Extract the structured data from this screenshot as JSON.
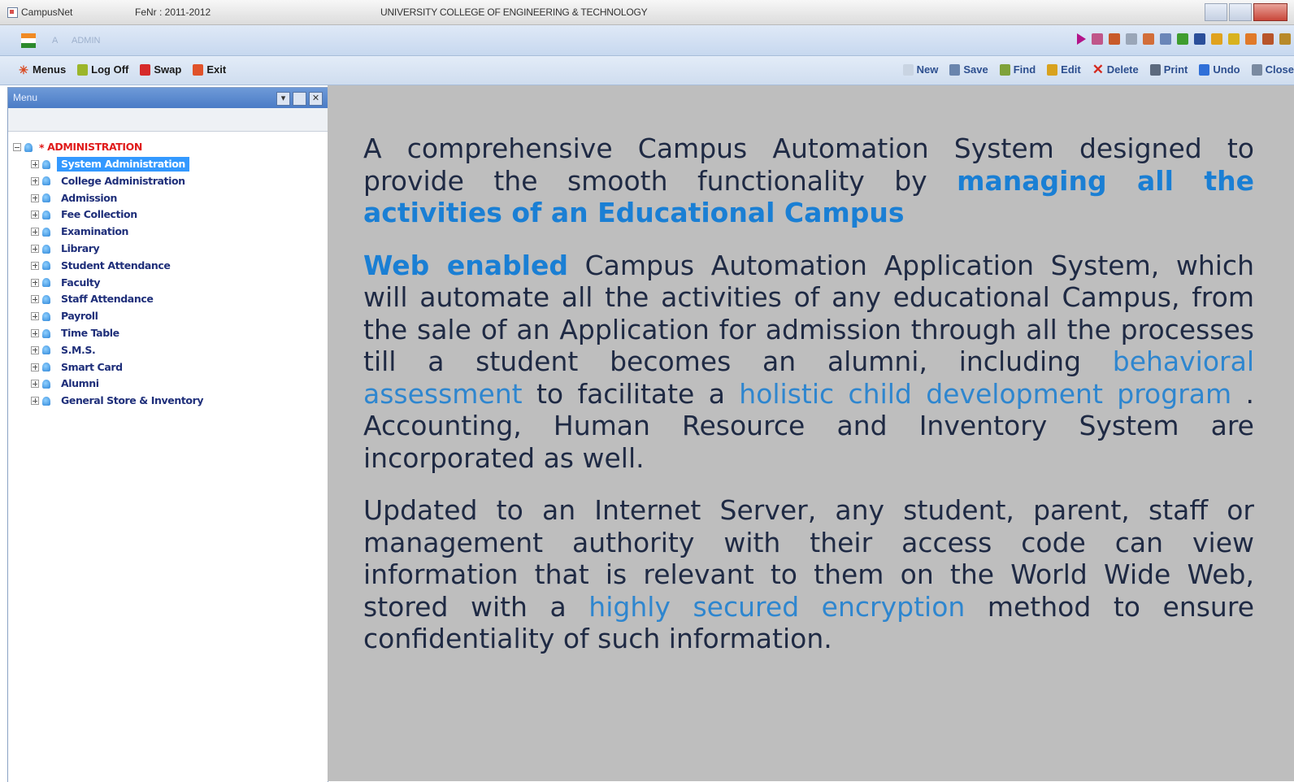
{
  "window": {
    "app_title": "CampusNet",
    "session": "FeNr : 2011-2012",
    "college": "UNIVERSITY COLLEGE OF ENGINEERING & TECHNOLOGY"
  },
  "userbar": {
    "mark": "A",
    "user": "ADMIN",
    "icons": [
      "play-icon",
      "grid-icon",
      "chart-icon",
      "document-icon",
      "people-icon",
      "user-icon",
      "check-icon",
      "power-icon",
      "refresh-icon",
      "folder-icon",
      "export-icon",
      "edit-icon",
      "lock-icon"
    ]
  },
  "toolbar": {
    "left": [
      {
        "label": "Menus",
        "icon": "star-icon",
        "color": "#d9481f"
      },
      {
        "label": "Log Off",
        "icon": "logoff-icon",
        "color": "#9bb62a"
      },
      {
        "label": "Swap",
        "icon": "swap-icon",
        "color": "#d62a2a"
      },
      {
        "label": "Exit",
        "icon": "exit-icon",
        "color": "#e0522a"
      }
    ],
    "right": [
      {
        "label": "New",
        "icon": "new-icon",
        "color": "#c9d4e2"
      },
      {
        "label": "Save",
        "icon": "save-icon",
        "color": "#6a85ad"
      },
      {
        "label": "Find",
        "icon": "find-icon",
        "color": "#7fa23a"
      },
      {
        "label": "Edit",
        "icon": "edit-icon",
        "color": "#d8a21e"
      },
      {
        "label": "Delete",
        "icon": "delete-icon",
        "color": "#d42a1f"
      },
      {
        "label": "Print",
        "icon": "print-icon",
        "color": "#5c6a7e"
      },
      {
        "label": "Undo",
        "icon": "undo-icon",
        "color": "#2f6fd8"
      },
      {
        "label": "Close",
        "icon": "close-icon",
        "color": "#7a8aa0"
      }
    ]
  },
  "menu_panel": {
    "title": "Menu",
    "root": "ADMINISTRATION",
    "items": [
      "System Administration",
      "College Administration",
      "Admission",
      "Fee Collection",
      "Examination",
      "Library",
      "Student Attendance",
      "Faculty",
      "Staff Attendance",
      "Payroll",
      "Time Table",
      "S.M.S.",
      "Smart Card",
      "Alumni",
      "General Store & Inventory"
    ],
    "selected_index": 0
  },
  "content": {
    "p1": {
      "text": "A comprehensive Campus Automation System designed to provide the smooth functionality by ",
      "highlight": "managing all the activities of an Educational Campus"
    },
    "p2": {
      "lead": "Web enabled",
      "text1": " Campus Automation Application System, which will automate all the activities of any educational Campus, from the sale of an Application for admission through all the processes till a student becomes an alumni, including ",
      "link1": "behavioral assessment",
      "text2": " to facilitate a ",
      "link2": "holistic child development program",
      "text3": " . Accounting, Human Resource and Inventory System are incorporated as well."
    },
    "p3": {
      "text1": "Updated to an Internet Server, any student, parent, staff or management authority with their access code can view information that is relevant to them on the World Wide Web, stored with a ",
      "link": "highly secured encryption",
      "text2": " method to ensure confidentiality of such information."
    }
  },
  "colors": {
    "content_bg": "#bebebe",
    "highlight": "#1a7fd4",
    "link": "#2e86cf",
    "tree_text": "#1f2f7a",
    "root_text": "#e01b1b",
    "selection": "#3399ff"
  }
}
